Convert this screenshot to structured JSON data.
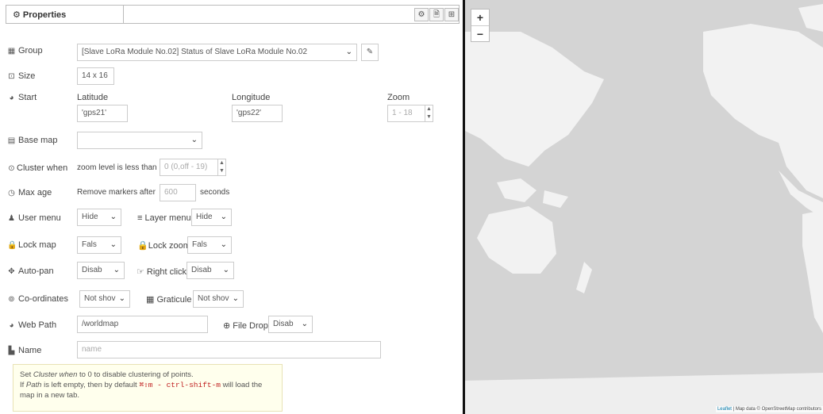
{
  "tabbar": {
    "title": "Properties"
  },
  "group": {
    "label": "Group",
    "value": "[Slave LoRa Module No.02] Status of Slave LoRa Module No.02"
  },
  "size": {
    "label": "Size",
    "value": "14 x 16"
  },
  "start": {
    "label": "Start",
    "latitude_label": "Latitude",
    "latitude_value": "'gps21'",
    "longitude_label": "Longitude",
    "longitude_value": "'gps22'",
    "zoom_label": "Zoom",
    "zoom_placeholder": "1 - 18"
  },
  "basemap": {
    "label": "Base map",
    "value": ""
  },
  "cluster": {
    "label": "Cluster when",
    "text": "zoom level is less than",
    "placeholder": "0 (0,off - 19)"
  },
  "maxage": {
    "label": "Max age",
    "text": "Remove markers after",
    "placeholder": "600",
    "unit": "seconds"
  },
  "usermenu": {
    "label": "User menu",
    "value": "Hide",
    "layermenu_label": "Layer menu",
    "layermenu_value": "Hide"
  },
  "lockmap": {
    "label": "Lock map",
    "value": "Fals",
    "lockzoom_label": "Lock zoom",
    "lockzoom_value": "Fals"
  },
  "autopan": {
    "label": "Auto-pan",
    "value": "Disab",
    "rightclick_label": "Right click",
    "rightclick_value": "Disab"
  },
  "coords": {
    "label": "Co-ordinates",
    "value": "Not shov",
    "graticule_label": "Graticule",
    "graticule_value": "Not shov"
  },
  "webpath": {
    "label": "Web Path",
    "value": "/worldmap",
    "filedrop_label": "File Drop",
    "filedrop_value": "Disab"
  },
  "name": {
    "label": "Name",
    "placeholder": "name"
  },
  "tip": {
    "line1_a": "Set ",
    "line1_em": "Cluster when",
    "line1_b": " to 0 to disable clustering of points.",
    "line2_a": "If ",
    "line2_em": "Path",
    "line2_b": " is left empty, then by default ",
    "line2_code": "⌘⇧m - ctrl-shift-m",
    "line2_c": " will load the",
    "line3": "map in a new tab."
  },
  "map": {
    "zoom_in": "+",
    "zoom_out": "−",
    "attribution_link": "Leaflet",
    "attribution_text": " | Map data © OpenStreetMap contributors"
  },
  "colors": {
    "land": "#f2f2f2",
    "water": "#d4d4d4"
  }
}
